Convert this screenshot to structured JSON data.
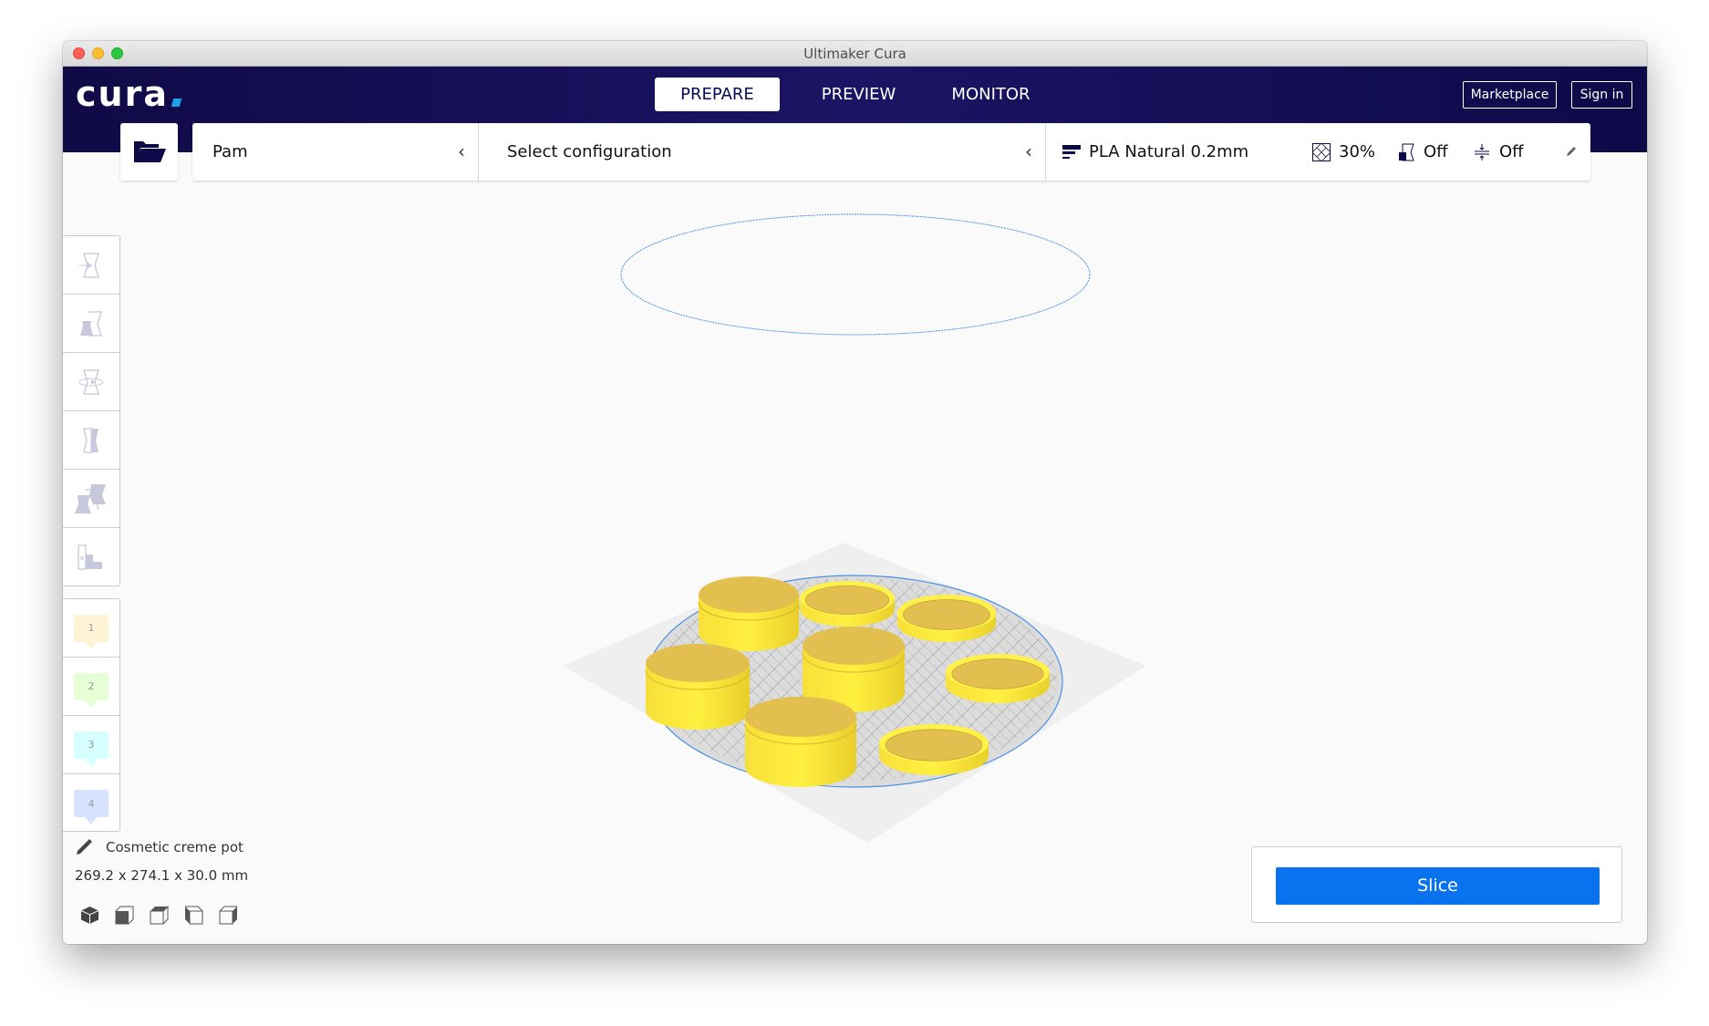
{
  "window": {
    "title": "Ultimaker Cura"
  },
  "header": {
    "logo": "cura",
    "tabs": [
      {
        "label": "PREPARE",
        "active": true
      },
      {
        "label": "PREVIEW",
        "active": false
      },
      {
        "label": "MONITOR",
        "active": false
      }
    ],
    "marketplace_label": "Marketplace",
    "signin_label": "Sign in"
  },
  "stage_bar": {
    "open_file_icon": "folder-open-icon",
    "printer": {
      "name": "Pam",
      "icon": "chevron-left-icon"
    },
    "configuration": {
      "label": "Select configuration",
      "icon": "chevron-left-icon"
    },
    "print_settings": {
      "profile": "PLA Natural 0.2mm",
      "infill": "30%",
      "support": "Off",
      "adhesion": "Off",
      "edit_icon": "pencil-icon"
    }
  },
  "left_toolbar": {
    "tools": [
      {
        "name": "move",
        "icon": "move-tool-icon"
      },
      {
        "name": "scale",
        "icon": "scale-tool-icon"
      },
      {
        "name": "rotate",
        "icon": "rotate-tool-icon"
      },
      {
        "name": "mirror",
        "icon": "mirror-tool-icon"
      },
      {
        "name": "per-model-settings",
        "icon": "per-model-settings-icon"
      },
      {
        "name": "support-blocker",
        "icon": "support-blocker-icon"
      }
    ],
    "extruders": [
      {
        "label": "1",
        "color": "#fff4d6"
      },
      {
        "label": "2",
        "color": "#e6ffd6"
      },
      {
        "label": "3",
        "color": "#d6ffff"
      },
      {
        "label": "4",
        "color": "#d6e2ff"
      }
    ]
  },
  "object_info": {
    "name": "Cosmetic creme pot",
    "dimensions": "269.2 x 274.1 x 30.0 mm"
  },
  "view_orientation": [
    "3d-view-icon",
    "front-view-icon",
    "top-view-icon",
    "left-view-icon",
    "right-view-icon"
  ],
  "slice_panel": {
    "button_label": "Slice"
  },
  "colors": {
    "header_bg": "#1b1464",
    "accent_blue": "#0972ef",
    "model_yellow": "#ffeb3b",
    "model_top": "#e5c050",
    "build_outline": "#4a90e2"
  }
}
